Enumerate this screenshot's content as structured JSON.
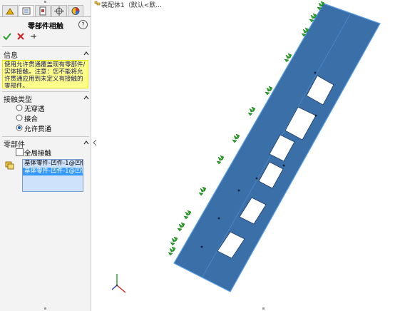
{
  "property_manager": {
    "tabs": [
      {
        "name": "feature-manager-tab",
        "icon": "feature-tree-icon"
      },
      {
        "name": "property-manager-tab",
        "icon": "property-manager-icon"
      },
      {
        "name": "configuration-manager-tab",
        "icon": "configuration-icon"
      },
      {
        "name": "dimxpert-tab",
        "icon": "crosshair-icon"
      },
      {
        "name": "display-manager-tab",
        "icon": "appearance-icon"
      }
    ],
    "title": "零部件相触",
    "help_glyph": "?",
    "info": {
      "title": "信息",
      "text": "使用允许贯通覆盖现有零部件/实体接触。注意：您不能将允许贯通应用到未定义有接触的零部件。"
    },
    "contact_type": {
      "title": "接触类型",
      "options": [
        "无穿透",
        "接合",
        "允许贯通"
      ],
      "selected": "允许贯通"
    },
    "components": {
      "title": "零部件",
      "global_contact_label": "全局接触",
      "global_contact_checked": false,
      "items": [
        "基体零件-凹件-1@凹件",
        "基体零件-凹件-1@凹件"
      ]
    }
  },
  "graphics": {
    "tree_label": "装配体1（默认<默..."
  },
  "colors": {
    "plate": "#3a6fa8",
    "plate_edge": "#5aa0e8",
    "fixture": "#22a822",
    "info_bg": "#ffff8c",
    "selection": "#3399ff"
  }
}
